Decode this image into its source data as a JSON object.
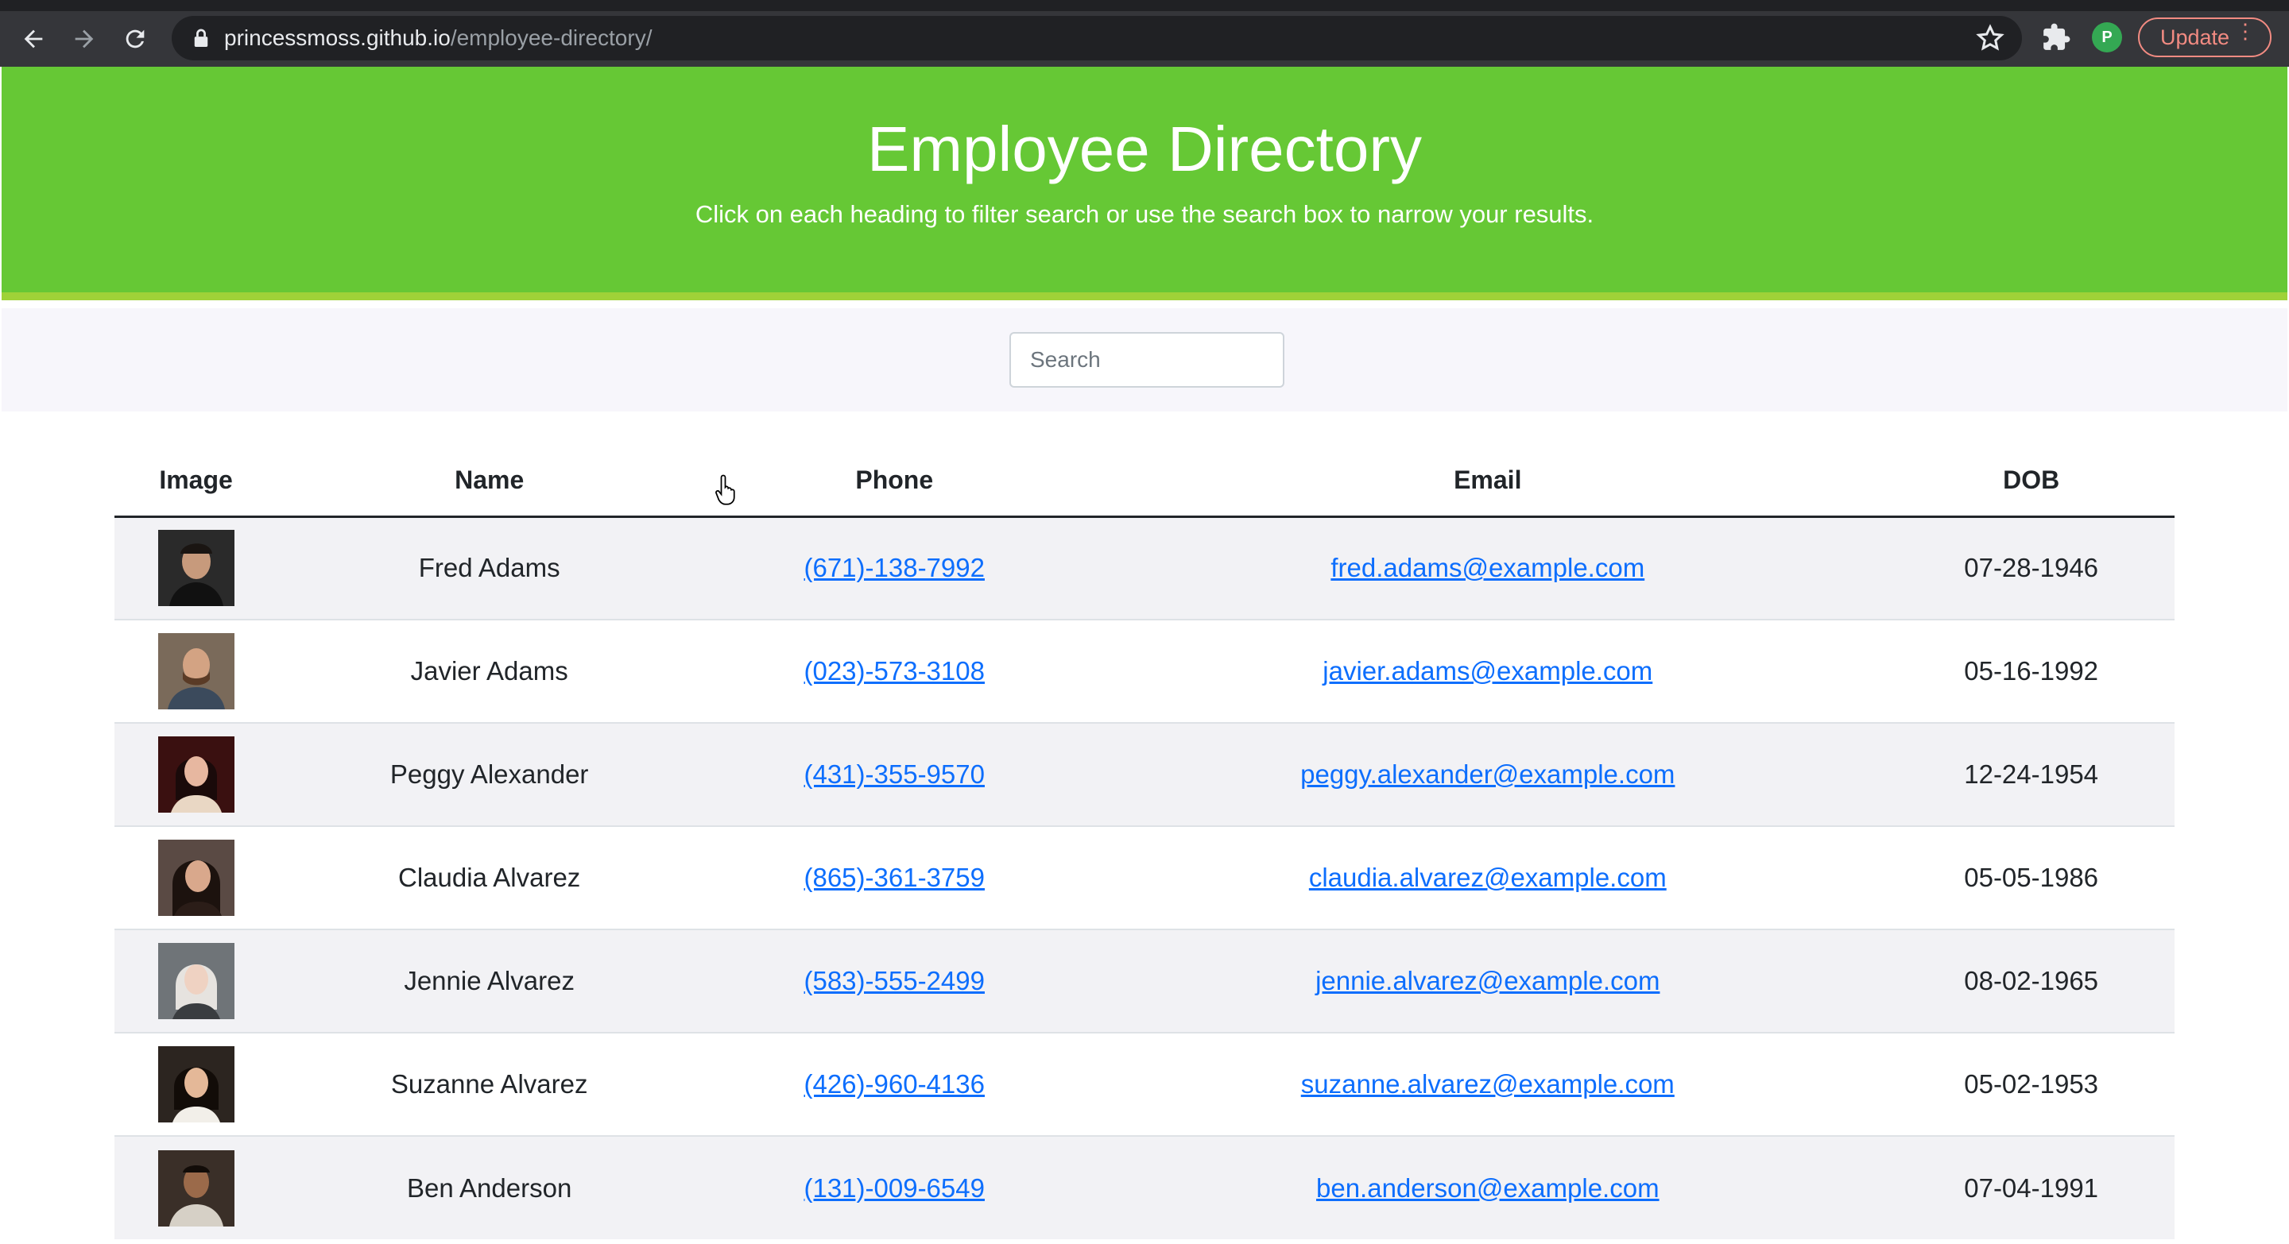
{
  "browser": {
    "url_host": "princessmoss.github.io",
    "url_path": "/employee-directory/",
    "profile_initial": "P",
    "update_label": "Update"
  },
  "header": {
    "title": "Employee Directory",
    "subtitle": "Click on each heading to filter search or use the search box to narrow your results."
  },
  "search": {
    "placeholder": "Search"
  },
  "table": {
    "columns": [
      "Image",
      "Name",
      "Phone",
      "Email",
      "DOB"
    ],
    "rows": [
      {
        "name": "Fred Adams",
        "phone": "(671)-138-7992",
        "email": "fred.adams@example.com",
        "dob": "07-28-1946"
      },
      {
        "name": "Javier Adams",
        "phone": "(023)-573-3108",
        "email": "javier.adams@example.com",
        "dob": "05-16-1992"
      },
      {
        "name": "Peggy Alexander",
        "phone": "(431)-355-9570",
        "email": "peggy.alexander@example.com",
        "dob": "12-24-1954"
      },
      {
        "name": "Claudia Alvarez",
        "phone": "(865)-361-3759",
        "email": "claudia.alvarez@example.com",
        "dob": "05-05-1986"
      },
      {
        "name": "Jennie Alvarez",
        "phone": "(583)-555-2499",
        "email": "jennie.alvarez@example.com",
        "dob": "08-02-1965"
      },
      {
        "name": "Suzanne Alvarez",
        "phone": "(426)-960-4136",
        "email": "suzanne.alvarez@example.com",
        "dob": "05-02-1953"
      },
      {
        "name": "Ben Anderson",
        "phone": "(131)-009-6549",
        "email": "ben.anderson@example.com",
        "dob": "07-04-1991"
      }
    ]
  },
  "colors": {
    "header_green": "#66c835",
    "link_blue": "#0d6efd",
    "chrome_dark": "#35363a"
  }
}
